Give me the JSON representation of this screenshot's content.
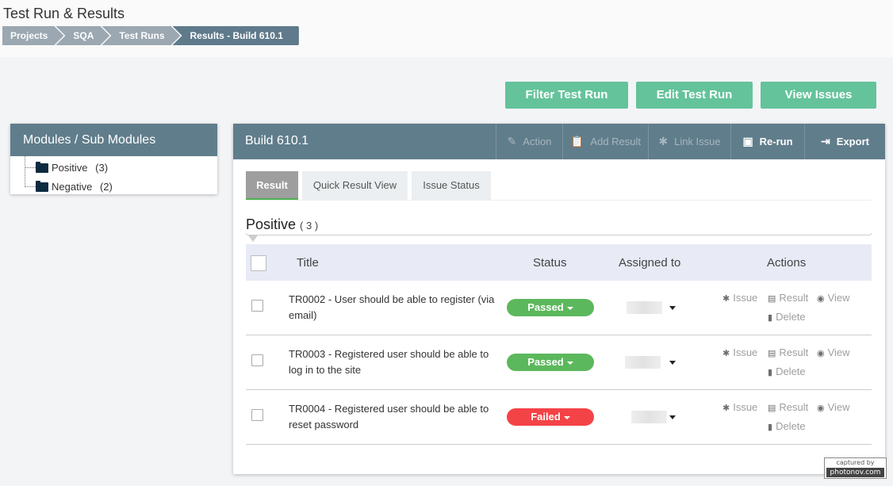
{
  "page": {
    "title": "Test Run & Results",
    "breadcrumb": [
      "Projects",
      "SQA",
      "Test Runs",
      "Results - Build 610.1"
    ]
  },
  "toolbar": {
    "filter_label": "Filter Test Run",
    "edit_label": "Edit Test Run",
    "issues_label": "View Issues"
  },
  "modules": {
    "header": "Modules / Sub Modules",
    "items": [
      {
        "label": "Positive",
        "count": "(3)"
      },
      {
        "label": "Negative",
        "count": "(2)"
      }
    ]
  },
  "main": {
    "title": "Build 610.1",
    "actions": [
      "Action",
      "Add Result",
      "Link Issue",
      "Re-run",
      "Export"
    ],
    "tabs": [
      "Result",
      "Quick Result View",
      "Issue Status"
    ],
    "section": {
      "title": "Positive",
      "count": "( 3 )"
    },
    "columns": [
      "Title",
      "Status",
      "Assigned to",
      "Actions"
    ],
    "row_actions": {
      "issue": "Issue",
      "result": "Result",
      "view": "View",
      "delete": "Delete"
    },
    "rows": [
      {
        "title": "TR0002 - User should be able to register (via email)",
        "status": "Passed",
        "status_color": "#5cb85c"
      },
      {
        "title": "TR0003 - Registered user should be able to log in to the site",
        "status": "Passed",
        "status_color": "#5cb85c"
      },
      {
        "title": "TR0004 - Registered user should be able to reset password",
        "status": "Failed",
        "status_color": "#f44347"
      }
    ]
  },
  "watermark": {
    "top": "captured by",
    "bottom": "photonov.com"
  },
  "colors": {
    "header": "#607d8b",
    "button": "#64c39b",
    "passed": "#5cb85c",
    "failed": "#f44347"
  }
}
